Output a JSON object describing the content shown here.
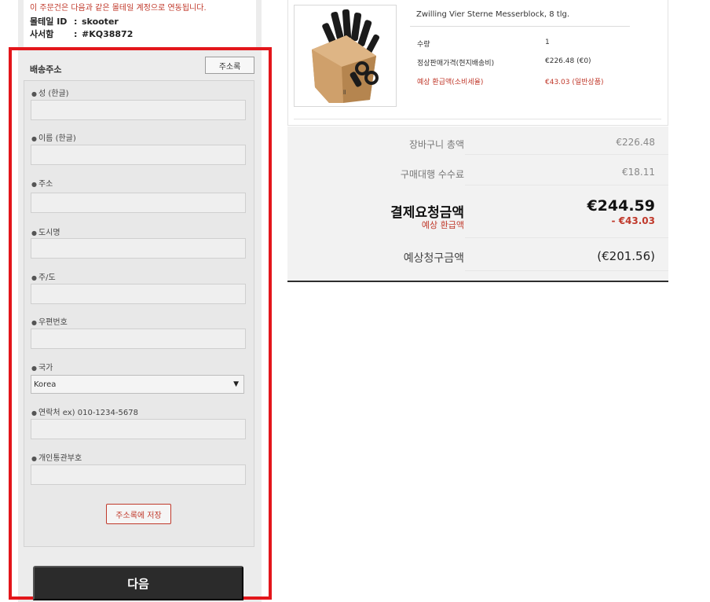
{
  "account": {
    "notice": "이 주문건은 다음과 같은 몰테일 계정으로 연동됩니다.",
    "id_label": "몰테일 ID",
    "id_value": "skooter",
    "box_label": "사서함",
    "box_value": "#KQ38872",
    "separator": ":"
  },
  "shipping": {
    "title": "배송주소",
    "address_book_label": "주소록",
    "fields": [
      {
        "label": "성 (한글)"
      },
      {
        "label": "이름 (한글)"
      },
      {
        "label": "주소"
      },
      {
        "label": "도시명"
      },
      {
        "label": "주/도"
      },
      {
        "label": "우편번호"
      },
      {
        "label": "국가"
      },
      {
        "label": "연락처 ex) 010-1234-5678"
      },
      {
        "label": "개인통관부호"
      }
    ],
    "country_selected": "Korea",
    "save_label": "주소록에 저장",
    "next_label": "다음"
  },
  "product": {
    "name": "Zwilling Vier Sterne Messerblock, 8 tlg.",
    "qty_label": "수량",
    "qty_value": "1",
    "price_label": "정상판매가격(현지배송비)",
    "price_value": "€226.48 (€0)",
    "refund_label": "예상 환급액(소비세율)",
    "refund_value": "€43.03 (일반상품)"
  },
  "summary": {
    "cart_total_label": "장바구니 총액",
    "cart_total_value": "€226.48",
    "fee_label": "구매대행 수수료",
    "fee_value": "€18.11",
    "payment_label": "결제요청금액",
    "payment_value": "€244.59",
    "refund_label": "예상 환급액",
    "refund_value": "- €43.03",
    "estimate_label": "예상청구금액",
    "estimate_value": "(€201.56)"
  },
  "colors": {
    "accent_red": "#e3161b",
    "text_red": "#c0392b",
    "dark_button": "#2b2b2b"
  }
}
